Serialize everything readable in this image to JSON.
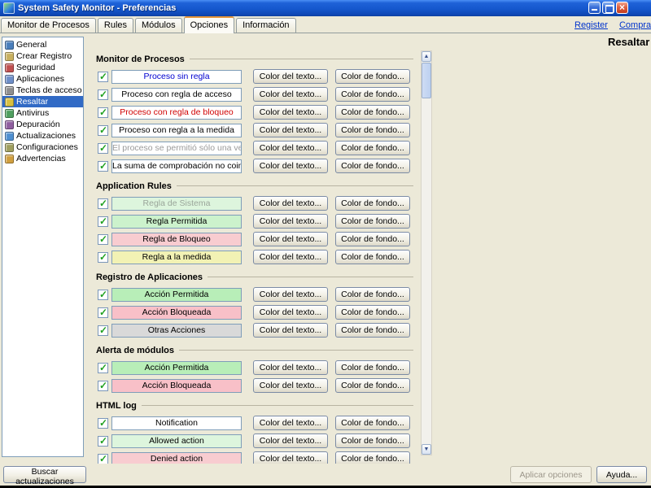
{
  "window": {
    "title": "System Safety Monitor - Preferencias"
  },
  "colors": {
    "selection": "#316ac5",
    "link": "#0033cc",
    "titlebar": "#1557cd"
  },
  "tabs": [
    {
      "label": "Monitor de Procesos",
      "selected": false
    },
    {
      "label": "Rules",
      "selected": false
    },
    {
      "label": "Módulos",
      "selected": false
    },
    {
      "label": "Opciones",
      "selected": true
    },
    {
      "label": "Información",
      "selected": false
    }
  ],
  "links": [
    {
      "label": "Register"
    },
    {
      "label": "Comprar ahora"
    }
  ],
  "page_title": "Resaltar",
  "sidebar": {
    "items": [
      {
        "label": "General",
        "icon": "general-icon",
        "color": "#4a7ebb",
        "selected": false
      },
      {
        "label": "Crear Registro",
        "icon": "log-icon",
        "color": "#c8b060",
        "selected": false
      },
      {
        "label": "Seguridad",
        "icon": "security-icon",
        "color": "#c05050",
        "selected": false
      },
      {
        "label": "Aplicaciones",
        "icon": "applications-icon",
        "color": "#6f8fc8",
        "selected": false
      },
      {
        "label": "Teclas de acceso r...",
        "icon": "hotkeys-icon",
        "color": "#8f8f8f",
        "selected": false
      },
      {
        "label": "Resaltar",
        "icon": "highlight-icon",
        "color": "#d8c040",
        "selected": true
      },
      {
        "label": "Antivirus",
        "icon": "antivirus-icon",
        "color": "#4f9f5f",
        "selected": false
      },
      {
        "label": "Depuración",
        "icon": "debug-icon",
        "color": "#8f5f9f",
        "selected": false
      },
      {
        "label": "Actualizaciones",
        "icon": "updates-icon",
        "color": "#4f8fd0",
        "selected": false
      },
      {
        "label": "Configuraciones",
        "icon": "settings-icon",
        "color": "#9f9f5f",
        "selected": false
      },
      {
        "label": "Advertencias",
        "icon": "warnings-icon",
        "color": "#d09f3f",
        "selected": false
      }
    ]
  },
  "row_buttons": {
    "text_color_label": "Color del texto...",
    "bg_color_label": "Color de fondo..."
  },
  "sections": [
    {
      "title": "Monitor de Procesos",
      "rows": [
        {
          "label": "Proceso sin regla",
          "checked": true,
          "text_color": "#0000d0",
          "bg_color": "#ffffff"
        },
        {
          "label": "Proceso con regla de acceso",
          "checked": true,
          "text_color": "#000000",
          "bg_color": "#ffffff"
        },
        {
          "label": "Proceso con regla de bloqueo",
          "checked": true,
          "text_color": "#d00000",
          "bg_color": "#ffffff"
        },
        {
          "label": "Proceso con regla a la medida",
          "checked": true,
          "text_color": "#000000",
          "bg_color": "#ffffff"
        },
        {
          "label": "El proceso se permitió sólo una vez",
          "checked": true,
          "text_color": "#9a9a9a",
          "bg_color": "#ffffff"
        },
        {
          "label": "La suma de comprobación no coincide",
          "checked": true,
          "text_color": "#000000",
          "bg_color": "#ffffff"
        }
      ]
    },
    {
      "title": "Application Rules",
      "rows": [
        {
          "label": "Regla de Sistema",
          "checked": true,
          "text_color": "#9aa59a",
          "bg_color": "#ddf5dd"
        },
        {
          "label": "Regla Permitida",
          "checked": true,
          "text_color": "#000000",
          "bg_color": "#ccf2cc"
        },
        {
          "label": "Regla de Bloqueo",
          "checked": true,
          "text_color": "#000000",
          "bg_color": "#f8ccd0"
        },
        {
          "label": "Regla a la medida",
          "checked": true,
          "text_color": "#000000",
          "bg_color": "#f2f2b4"
        }
      ]
    },
    {
      "title": "Registro de Aplicaciones",
      "rows": [
        {
          "label": "Acción Permitida",
          "checked": true,
          "text_color": "#000000",
          "bg_color": "#b8eeb8"
        },
        {
          "label": "Acción Bloqueada",
          "checked": true,
          "text_color": "#000000",
          "bg_color": "#f8c0c8"
        },
        {
          "label": "Otras Acciones",
          "checked": true,
          "text_color": "#000000",
          "bg_color": "#d9d9d9"
        }
      ]
    },
    {
      "title": "Alerta de módulos",
      "rows": [
        {
          "label": "Acción Permitida",
          "checked": true,
          "text_color": "#000000",
          "bg_color": "#b8eeb8"
        },
        {
          "label": "Acción Bloqueada",
          "checked": true,
          "text_color": "#000000",
          "bg_color": "#f8c0c8"
        }
      ]
    },
    {
      "title": "HTML log",
      "rows": [
        {
          "label": "Notification",
          "checked": true,
          "text_color": "#000000",
          "bg_color": "#ffffff"
        },
        {
          "label": "Allowed action",
          "checked": true,
          "text_color": "#000000",
          "bg_color": "#ddf5dd"
        },
        {
          "label": "Denied action",
          "checked": true,
          "text_color": "#000000",
          "bg_color": "#f8ccd0"
        }
      ]
    }
  ],
  "footer": {
    "check_updates_label": "Buscar actualizaciones",
    "apply_label": "Aplicar opciones",
    "apply_enabled": false,
    "help_label": "Ayuda..."
  }
}
